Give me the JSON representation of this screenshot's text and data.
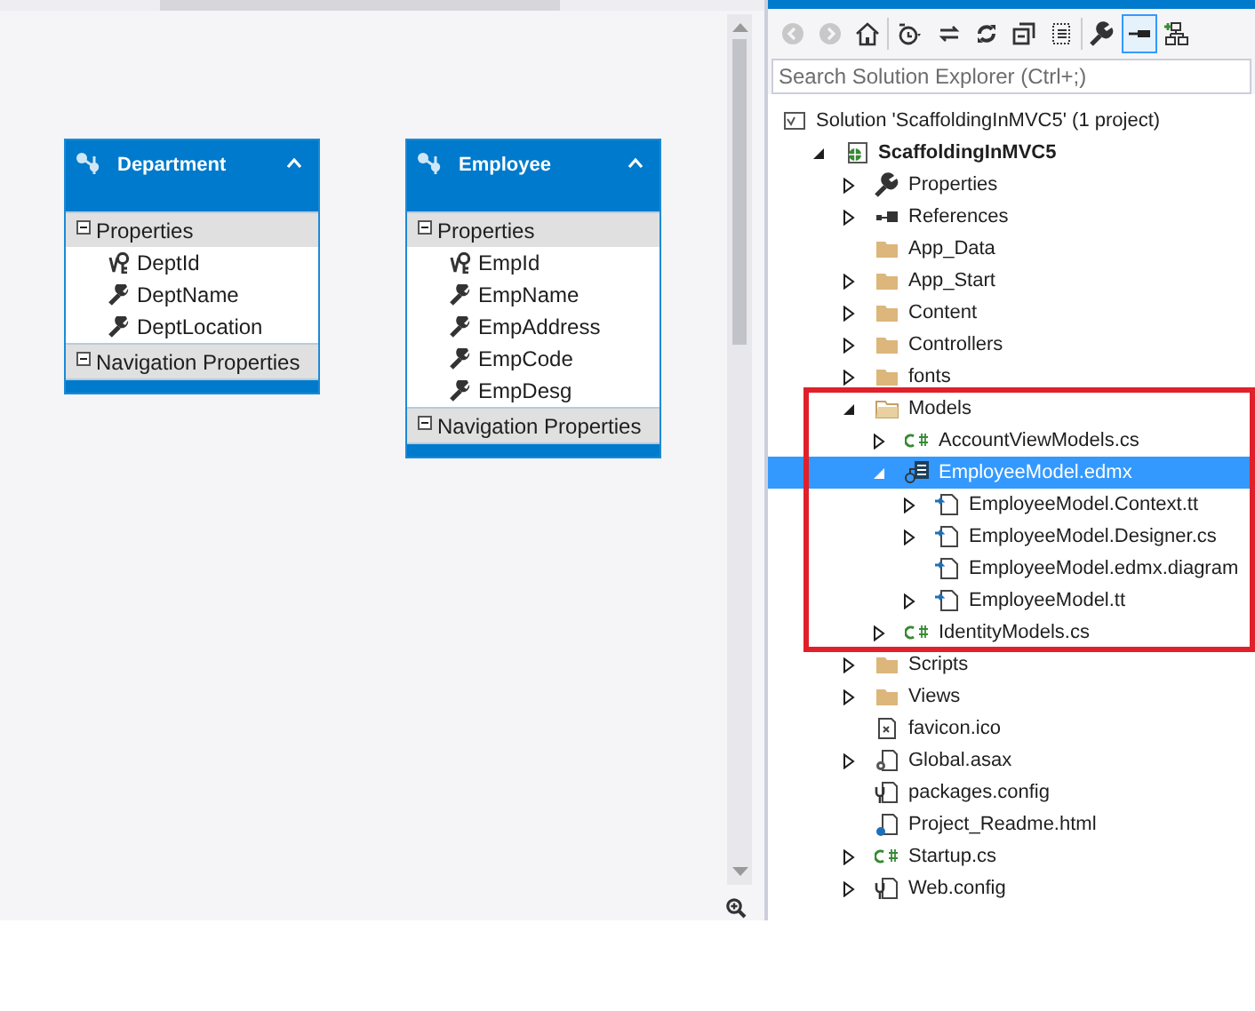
{
  "designer": {
    "entities": [
      {
        "name": "Department",
        "collapsed": false,
        "sections": [
          {
            "label": "Properties",
            "expanded": true,
            "items": [
              {
                "name": "DeptId",
                "kind": "key"
              },
              {
                "name": "DeptName",
                "kind": "scalar"
              },
              {
                "name": "DeptLocation",
                "kind": "scalar"
              }
            ]
          },
          {
            "label": "Navigation Properties",
            "expanded": true
          }
        ]
      },
      {
        "name": "Employee",
        "collapsed": false,
        "sections": [
          {
            "label": "Properties",
            "expanded": true,
            "items": [
              {
                "name": "EmpId",
                "kind": "key"
              },
              {
                "name": "EmpName",
                "kind": "scalar"
              },
              {
                "name": "EmpAddress",
                "kind": "scalar"
              },
              {
                "name": "EmpCode",
                "kind": "scalar"
              },
              {
                "name": "EmpDesg",
                "kind": "scalar"
              }
            ]
          },
          {
            "label": "Navigation Properties",
            "expanded": true
          }
        ]
      }
    ]
  },
  "solution_explorer": {
    "toolbar": [
      {
        "kind": "back",
        "selected": false
      },
      {
        "kind": "forward",
        "selected": false
      },
      {
        "kind": "home",
        "selected": false
      },
      {
        "kind": "history",
        "selected": false
      },
      {
        "kind": "sync",
        "selected": false
      },
      {
        "kind": "refresh",
        "selected": false
      },
      {
        "kind": "collapse",
        "selected": false
      },
      {
        "kind": "show-all",
        "selected": false
      },
      {
        "kind": "properties",
        "selected": false
      },
      {
        "kind": "preview",
        "selected": true
      },
      {
        "kind": "diagram",
        "selected": false
      }
    ],
    "search": {
      "placeholder": "Search Solution Explorer (Ctrl+;)"
    },
    "tree": [
      {
        "label": "Solution 'ScaffoldingInMVC5' (1 project)",
        "kind": "solution",
        "selected": false,
        "bold": false,
        "children": [
          {
            "label": "ScaffoldingInMVC5",
            "kind": "project",
            "expanded": true,
            "selected": false,
            "bold": true,
            "children": [
              {
                "label": "Properties",
                "kind": "properties",
                "expanded": false,
                "selected": false,
                "bold": false
              },
              {
                "label": "References",
                "kind": "references",
                "expanded": false,
                "selected": false,
                "bold": false
              },
              {
                "label": "App_Data",
                "kind": "folder",
                "selected": false,
                "bold": false
              },
              {
                "label": "App_Start",
                "kind": "folder",
                "expanded": false,
                "selected": false,
                "bold": false
              },
              {
                "label": "Content",
                "kind": "folder",
                "expanded": false,
                "selected": false,
                "bold": false
              },
              {
                "label": "Controllers",
                "kind": "folder",
                "expanded": false,
                "selected": false,
                "bold": false
              },
              {
                "label": "fonts",
                "kind": "folder",
                "expanded": false,
                "selected": false,
                "bold": false
              },
              {
                "label": "Models",
                "kind": "folder-open",
                "expanded": true,
                "selected": false,
                "bold": false,
                "highlighted": true,
                "children": [
                  {
                    "label": "AccountViewModels.cs",
                    "kind": "cs",
                    "expanded": false,
                    "selected": false,
                    "bold": false
                  },
                  {
                    "label": "EmployeeModel.edmx",
                    "kind": "edmx",
                    "expanded": true,
                    "selected": true,
                    "bold": false,
                    "children": [
                      {
                        "label": "EmployeeModel.Context.tt",
                        "kind": "tt",
                        "expanded": false,
                        "selected": false,
                        "bold": false
                      },
                      {
                        "label": "EmployeeModel.Designer.cs",
                        "kind": "tt",
                        "expanded": false,
                        "selected": false,
                        "bold": false
                      },
                      {
                        "label": "EmployeeModel.edmx.diagram",
                        "kind": "tt",
                        "selected": false,
                        "bold": false
                      },
                      {
                        "label": "EmployeeModel.tt",
                        "kind": "tt",
                        "expanded": false,
                        "selected": false,
                        "bold": false
                      }
                    ]
                  },
                  {
                    "label": "IdentityModels.cs",
                    "kind": "cs",
                    "expanded": false,
                    "selected": false,
                    "bold": false
                  }
                ]
              },
              {
                "label": "Scripts",
                "kind": "folder",
                "expanded": false,
                "selected": false,
                "bold": false
              },
              {
                "label": "Views",
                "kind": "folder",
                "expanded": false,
                "selected": false,
                "bold": false
              },
              {
                "label": "favicon.ico",
                "kind": "ico",
                "selected": false,
                "bold": false
              },
              {
                "label": "Global.asax",
                "kind": "asax",
                "expanded": false,
                "selected": false,
                "bold": false
              },
              {
                "label": "packages.config",
                "kind": "config",
                "selected": false,
                "bold": false
              },
              {
                "label": "Project_Readme.html",
                "kind": "html",
                "selected": false,
                "bold": false
              },
              {
                "label": "Startup.cs",
                "kind": "cs",
                "expanded": false,
                "selected": false,
                "bold": false
              },
              {
                "label": "Web.config",
                "kind": "config",
                "expanded": false,
                "selected": false,
                "bold": false
              }
            ]
          }
        ]
      }
    ]
  }
}
